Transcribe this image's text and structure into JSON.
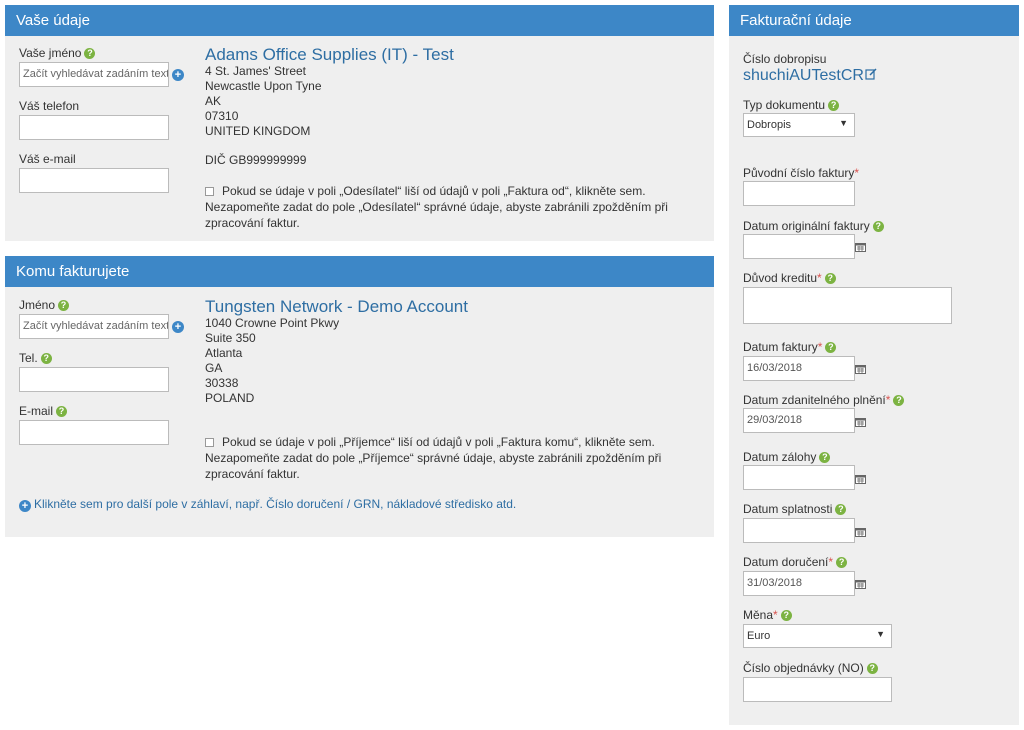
{
  "vase_udaje": {
    "title": "Vaše údaje",
    "name_label": "Vaše jméno",
    "name_placeholder": "Začít vyhledávat zadáním textu",
    "phone_label": "Váš telefon",
    "email_label": "Váš e-mail",
    "company": "Adams Office Supplies (IT) - Test",
    "address": [
      "4 St. James' Street",
      "Newcastle Upon Tyne",
      "AK",
      "07310",
      "UNITED KINGDOM"
    ],
    "vat": "DIČ GB999999999",
    "note_line1": "Pokud se údaje v poli „Odesílatel“ liší od údajů v poli „Faktura od“, klikněte sem.",
    "note_line2": "Nezapomeňte zadat do pole „Odesílatel“ správné údaje, abyste zabránili zpožděním při",
    "note_line3": "zpracování faktur."
  },
  "komu_fakturujete": {
    "title": "Komu fakturujete",
    "name_label": "Jméno",
    "name_placeholder": "Začít vyhledávat zadáním textu",
    "phone_label": "Tel.",
    "email_label": "E-mail",
    "company": "Tungsten Network - Demo Account",
    "address": [
      "1040 Crowne Point Pkwy",
      "Suite 350",
      "Atlanta",
      "GA",
      "30338",
      "POLAND"
    ],
    "note_line1": "Pokud se údaje v poli „Příjemce“ liší od údajů v poli „Faktura komu“, klikněte sem.",
    "note_line2": "Nezapomeňte zadat do pole „Příjemce“ správné údaje, abyste zabránili zpožděním při",
    "note_line3": "zpracování faktur.",
    "more_link": "Klikněte sem pro další pole v záhlaví, např. Číslo doručení / GRN, nákladové středisko atd."
  },
  "fakturacni_udaje": {
    "title": "Fakturační údaje",
    "credit_no_label": "Číslo dobropisu",
    "credit_no_value": "shuchiAUTestCR",
    "doc_type_label": "Typ dokumentu",
    "doc_type_value": "Dobropis",
    "orig_invoice_label": "Původní číslo faktury",
    "orig_invoice_date_label": "Datum originální faktury",
    "credit_reason_label": "Důvod kreditu",
    "invoice_date_label": "Datum faktury",
    "invoice_date_value": "16/03/2018",
    "tax_date_label": "Datum zdanitelného plnění",
    "tax_date_value": "29/03/2018",
    "deposit_date_label": "Datum zálohy",
    "due_date_label": "Datum splatnosti",
    "delivery_date_label": "Datum doručení",
    "delivery_date_value": "31/03/2018",
    "currency_label": "Měna",
    "currency_value": "Euro",
    "po_label": "Číslo objednávky (NO)"
  },
  "icons": {
    "help": "help-icon",
    "add": "add-contact-icon",
    "calendar": "calendar-icon",
    "edit": "edit-icon"
  },
  "colors": {
    "header": "#3d87c7",
    "panel": "#efefef",
    "link": "#2e6ea3",
    "help": "#7cb342",
    "required": "#d9534f"
  }
}
